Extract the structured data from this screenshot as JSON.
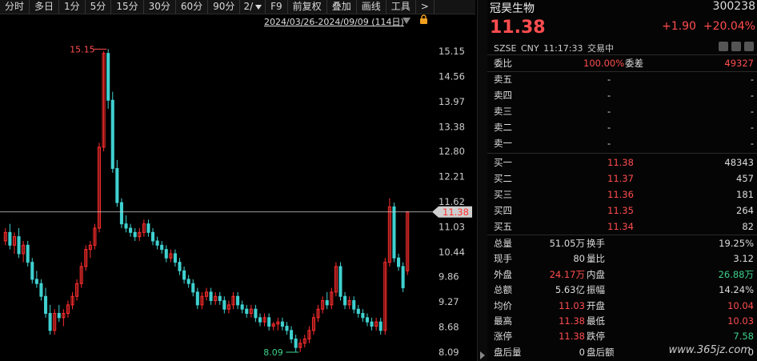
{
  "toolbar": {
    "items": [
      "分时",
      "多日",
      "1分",
      "5分",
      "15分",
      "30分",
      "60分",
      "90分",
      "2/",
      "F9",
      "前复权",
      "叠加",
      "画线",
      "工具",
      ">"
    ],
    "date_range": "2024/03/26-2024/09/09 (114日)"
  },
  "chart_data": {
    "type": "candlestick",
    "y_ticks": [
      "15.15",
      "14.56",
      "13.97",
      "13.38",
      "12.80",
      "12.21",
      "11.62",
      "11.03",
      "10.44",
      "9.86",
      "9.27",
      "8.68",
      "8.09"
    ],
    "ylim": [
      8.09,
      15.15
    ],
    "max_annotation": "15.15",
    "min_annotation": "8.09",
    "current_price_label": "11.38",
    "current_price": 11.38,
    "candles": [
      [
        10.7,
        11.0,
        10.6,
        10.9
      ],
      [
        10.9,
        11.1,
        10.5,
        10.6
      ],
      [
        10.6,
        10.9,
        10.4,
        10.8
      ],
      [
        10.8,
        11.0,
        10.3,
        10.4
      ],
      [
        10.4,
        10.7,
        10.2,
        10.6
      ],
      [
        10.6,
        10.7,
        10.1,
        10.2
      ],
      [
        10.2,
        10.3,
        9.7,
        9.8
      ],
      [
        9.8,
        10.0,
        9.6,
        9.7
      ],
      [
        9.7,
        9.8,
        9.3,
        9.4
      ],
      [
        9.4,
        9.6,
        8.9,
        9.0
      ],
      [
        9.0,
        9.2,
        8.5,
        8.6
      ],
      [
        8.6,
        9.1,
        8.5,
        9.0
      ],
      [
        9.0,
        9.2,
        8.8,
        8.9
      ],
      [
        8.9,
        9.1,
        8.7,
        9.0
      ],
      [
        9.0,
        9.3,
        8.9,
        9.2
      ],
      [
        9.2,
        9.5,
        9.1,
        9.4
      ],
      [
        9.4,
        9.8,
        9.3,
        9.7
      ],
      [
        9.7,
        10.2,
        9.6,
        10.1
      ],
      [
        10.1,
        10.6,
        10.0,
        10.5
      ],
      [
        10.5,
        10.7,
        10.3,
        10.6
      ],
      [
        10.6,
        11.1,
        10.5,
        11.0
      ],
      [
        11.0,
        13.0,
        10.9,
        12.9
      ],
      [
        12.9,
        15.15,
        12.8,
        15.1
      ],
      [
        15.1,
        15.2,
        13.8,
        14.0
      ],
      [
        14.0,
        14.2,
        12.3,
        12.4
      ],
      [
        12.4,
        12.6,
        11.5,
        11.6
      ],
      [
        11.6,
        11.7,
        11.0,
        11.1
      ],
      [
        11.1,
        11.3,
        10.9,
        11.0
      ],
      [
        11.0,
        11.1,
        10.8,
        10.9
      ],
      [
        10.9,
        11.0,
        10.7,
        10.8
      ],
      [
        10.8,
        11.0,
        10.7,
        10.9
      ],
      [
        10.9,
        11.2,
        10.8,
        11.1
      ],
      [
        11.1,
        11.2,
        10.8,
        10.9
      ],
      [
        10.9,
        11.0,
        10.6,
        10.7
      ],
      [
        10.7,
        10.8,
        10.5,
        10.6
      ],
      [
        10.6,
        10.7,
        10.4,
        10.5
      ],
      [
        10.5,
        10.6,
        10.2,
        10.3
      ],
      [
        10.3,
        10.5,
        10.2,
        10.4
      ],
      [
        10.4,
        10.5,
        10.1,
        10.2
      ],
      [
        10.2,
        10.3,
        9.9,
        10.0
      ],
      [
        10.0,
        10.1,
        9.7,
        9.8
      ],
      [
        9.8,
        9.9,
        9.6,
        9.7
      ],
      [
        9.7,
        9.8,
        9.4,
        9.5
      ],
      [
        9.5,
        9.6,
        9.1,
        9.2
      ],
      [
        9.2,
        9.5,
        9.1,
        9.4
      ],
      [
        9.4,
        9.6,
        9.3,
        9.5
      ],
      [
        9.5,
        9.6,
        9.2,
        9.3
      ],
      [
        9.3,
        9.5,
        9.2,
        9.4
      ],
      [
        9.4,
        9.5,
        9.2,
        9.3
      ],
      [
        9.3,
        9.4,
        9.0,
        9.1
      ],
      [
        9.1,
        9.3,
        9.0,
        9.2
      ],
      [
        9.2,
        9.5,
        9.1,
        9.4
      ],
      [
        9.4,
        9.5,
        9.1,
        9.2
      ],
      [
        9.2,
        9.3,
        9.0,
        9.1
      ],
      [
        9.1,
        9.2,
        8.9,
        9.0
      ],
      [
        9.0,
        9.2,
        8.9,
        9.1
      ],
      [
        9.1,
        9.2,
        8.8,
        8.9
      ],
      [
        8.9,
        9.0,
        8.7,
        8.8
      ],
      [
        8.8,
        9.0,
        8.7,
        8.9
      ],
      [
        8.9,
        9.0,
        8.6,
        8.7
      ],
      [
        8.7,
        8.8,
        8.6,
        8.75
      ],
      [
        8.75,
        8.9,
        8.6,
        8.8
      ],
      [
        8.8,
        8.9,
        8.6,
        8.7
      ],
      [
        8.7,
        8.8,
        8.5,
        8.6
      ],
      [
        8.6,
        8.7,
        8.3,
        8.4
      ],
      [
        8.4,
        8.5,
        8.1,
        8.2
      ],
      [
        8.2,
        8.4,
        8.09,
        8.3
      ],
      [
        8.3,
        8.5,
        8.2,
        8.4
      ],
      [
        8.4,
        8.7,
        8.3,
        8.6
      ],
      [
        8.6,
        9.0,
        8.5,
        8.9
      ],
      [
        8.9,
        9.2,
        8.8,
        9.1
      ],
      [
        9.1,
        9.4,
        9.0,
        9.3
      ],
      [
        9.3,
        9.5,
        9.1,
        9.2
      ],
      [
        9.2,
        9.6,
        9.1,
        9.5
      ],
      [
        9.5,
        10.2,
        9.4,
        10.1
      ],
      [
        10.1,
        10.2,
        9.3,
        9.4
      ],
      [
        9.4,
        9.5,
        9.1,
        9.2
      ],
      [
        9.2,
        9.4,
        9.1,
        9.3
      ],
      [
        9.3,
        9.4,
        9.0,
        9.1
      ],
      [
        9.1,
        9.2,
        8.9,
        9.0
      ],
      [
        9.0,
        9.1,
        8.8,
        8.9
      ],
      [
        8.9,
        9.0,
        8.7,
        8.8
      ],
      [
        8.8,
        8.9,
        8.6,
        8.7
      ],
      [
        8.7,
        8.9,
        8.6,
        8.8
      ],
      [
        8.8,
        8.9,
        8.5,
        8.6
      ],
      [
        8.6,
        10.3,
        8.5,
        10.2
      ],
      [
        10.2,
        11.7,
        10.1,
        11.5
      ],
      [
        11.5,
        11.6,
        10.2,
        10.3
      ],
      [
        10.3,
        10.4,
        10.0,
        10.1
      ],
      [
        10.1,
        10.2,
        9.5,
        9.6
      ],
      [
        10.0,
        11.4,
        9.9,
        11.38
      ]
    ]
  },
  "panel": {
    "name": "冠昊生物",
    "code": "300238",
    "price": "11.38",
    "change": "+1.90",
    "change_pct": "+20.04%",
    "info": "SZSE  CNY  11:17:33  交易中",
    "weibi_label": "委比",
    "weibi_value": "100.00%",
    "weicha_label": "委差",
    "weicha_value": "49327",
    "asks": [
      {
        "label": "卖五",
        "price": "-",
        "vol": "-"
      },
      {
        "label": "卖四",
        "price": "-",
        "vol": "-"
      },
      {
        "label": "卖三",
        "price": "-",
        "vol": "-"
      },
      {
        "label": "卖二",
        "price": "-",
        "vol": "-"
      },
      {
        "label": "卖一",
        "price": "-",
        "vol": "-"
      }
    ],
    "bids": [
      {
        "label": "买一",
        "price": "11.38",
        "vol": "48343"
      },
      {
        "label": "买二",
        "price": "11.37",
        "vol": "457"
      },
      {
        "label": "买三",
        "price": "11.36",
        "vol": "181"
      },
      {
        "label": "买四",
        "price": "11.35",
        "vol": "264"
      },
      {
        "label": "买五",
        "price": "11.34",
        "vol": "82"
      }
    ],
    "stats": [
      {
        "l1": "总量",
        "v1": "51.05万",
        "c1": "white",
        "l2": "换手",
        "v2": "19.25%",
        "c2": "white"
      },
      {
        "l1": "现手",
        "v1": "80",
        "c1": "white",
        "l2": "量比",
        "v2": "3.12",
        "c2": "white"
      },
      {
        "l1": "外盘",
        "v1": "24.17万",
        "c1": "red",
        "l2": "内盘",
        "v2": "26.88万",
        "c2": "green"
      },
      {
        "l1": "总额",
        "v1": "5.63亿",
        "c1": "white",
        "l2": "振幅",
        "v2": "14.24%",
        "c2": "white"
      },
      {
        "l1": "均价",
        "v1": "11.03",
        "c1": "red",
        "l2": "开盘",
        "v2": "10.04",
        "c2": "red"
      },
      {
        "l1": "最高",
        "v1": "11.38",
        "c1": "red",
        "l2": "最低",
        "v2": "10.03",
        "c2": "red"
      },
      {
        "l1": "涨停",
        "v1": "11.38",
        "c1": "red",
        "l2": "跌停",
        "v2": "7.58",
        "c2": "green"
      },
      {
        "l1": "盘后量",
        "v1": "0",
        "c1": "white",
        "l2": "盘后额",
        "v2": "0",
        "c2": "white"
      }
    ],
    "watermark": "www.365jz.com"
  },
  "colors": {
    "up": "#ff2d2d",
    "down": "#40d0d0",
    "price_line": "#d0d0d0"
  }
}
